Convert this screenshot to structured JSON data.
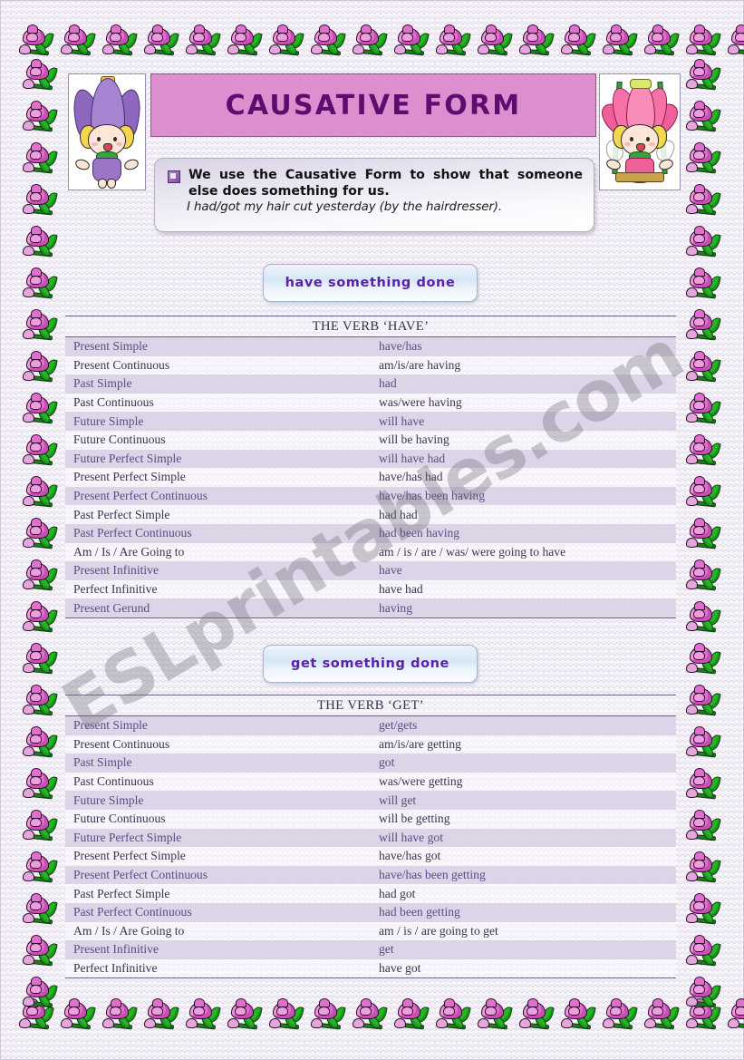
{
  "document": {
    "title": "CAUSATIVE FORM",
    "watermark": "ESLprintables.com"
  },
  "callout": {
    "icon": "note-icon",
    "main_text": "We use the Causative Form to show that someone else does something for us.",
    "example_text": "I had/got my hair cut yesterday (by the hairdresser)."
  },
  "illustrations": {
    "left_mascot": "tulip-fairy-illustration",
    "right_mascot": "lotus-fairy-swing-illustration",
    "border": "rose-border-pattern"
  },
  "sections": [
    {
      "pill_label": "have something done",
      "table_header": "THE VERB ‘HAVE’",
      "rows": [
        {
          "form": "Present Simple",
          "value": "have/has"
        },
        {
          "form": "Present Continuous",
          "value": "am/is/are having"
        },
        {
          "form": "Past Simple",
          "value": "had"
        },
        {
          "form": "Past Continuous",
          "value": "was/were having"
        },
        {
          "form": "Future Simple",
          "value": "will have"
        },
        {
          "form": "Future Continuous",
          "value": "will be having"
        },
        {
          "form": "Future Perfect Simple",
          "value": "will have had"
        },
        {
          "form": "Present Perfect Simple",
          "value": "have/has had"
        },
        {
          "form": "Present Perfect Continuous",
          "value": "have/has been having"
        },
        {
          "form": "Past Perfect Simple",
          "value": "had had"
        },
        {
          "form": "Past Perfect Continuous",
          "value": "had been having"
        },
        {
          "form": "Am / Is / Are Going to",
          "value": "am / is / are / was/ were going to have"
        },
        {
          "form": "Present Infinitive",
          "value": "have"
        },
        {
          "form": "Perfect Infinitive",
          "value": "have had"
        },
        {
          "form": "Present Gerund",
          "value": "having"
        }
      ]
    },
    {
      "pill_label": "get something done",
      "table_header": "THE VERB ‘GET’",
      "rows": [
        {
          "form": "Present Simple",
          "value": "get/gets"
        },
        {
          "form": "Present Continuous",
          "value": "am/is/are getting"
        },
        {
          "form": "Past Simple",
          "value": "got"
        },
        {
          "form": "Past Continuous",
          "value": "was/were getting"
        },
        {
          "form": "Future Simple",
          "value": "will get"
        },
        {
          "form": "Future Continuous",
          "value": "will be getting"
        },
        {
          "form": "Future Perfect Simple",
          "value": "will have got"
        },
        {
          "form": "Present Perfect Simple",
          "value": "have/has got"
        },
        {
          "form": "Present Perfect Continuous",
          "value": "have/has been getting"
        },
        {
          "form": "Past Perfect Simple",
          "value": "had got"
        },
        {
          "form": "Past Perfect Continuous",
          "value": "had been getting"
        },
        {
          "form": "Am / Is / Are Going to",
          "value": "am / is / are going to get"
        },
        {
          "form": "Present Infinitive",
          "value": "get"
        },
        {
          "form": "Perfect Infinitive",
          "value": "have got"
        }
      ]
    }
  ],
  "colors": {
    "title_band": "#dd8ecf",
    "title_text": "#5c0e6e",
    "row_shade": "#dcd5e7",
    "row_shade_text": "#5c4b84",
    "row_plain_text": "#3b3450",
    "pill_text": "#5b21a8",
    "page_bg": "#f7f4fa"
  }
}
